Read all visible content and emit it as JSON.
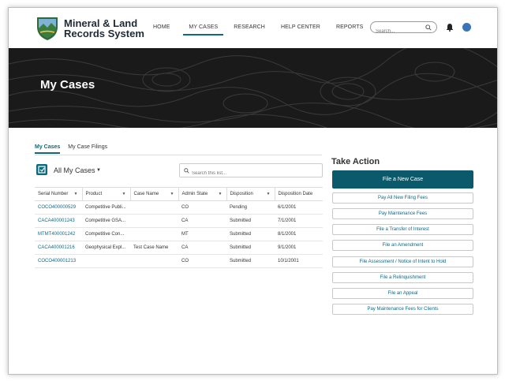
{
  "app": {
    "title_line1": "Mineral & Land",
    "title_line2": "Records System"
  },
  "nav": [
    {
      "label": "HOME"
    },
    {
      "label": "MY CASES"
    },
    {
      "label": "RESEARCH"
    },
    {
      "label": "HELP CENTER"
    },
    {
      "label": "REPORTS"
    }
  ],
  "search": {
    "placeholder": "Search..."
  },
  "hero": {
    "title": "My Cases"
  },
  "tabs": [
    {
      "label": "My Cases"
    },
    {
      "label": "My Case Filings"
    }
  ],
  "list_view": {
    "label": "All My Cases",
    "search_placeholder": "Search this list..."
  },
  "table": {
    "columns": [
      "Serial Number",
      "Product",
      "Case Name",
      "Admin State",
      "Disposition",
      "Disposition Date"
    ],
    "rows": [
      [
        "COCO400000529",
        "Competitive Publi...",
        "",
        "CO",
        "Pending",
        "6/1/2001"
      ],
      [
        "CACA400001243",
        "Competitive GSA...",
        "",
        "CA",
        "Submitted",
        "7/1/2001"
      ],
      [
        "MTMT400001242",
        "Competitive Con...",
        "",
        "MT",
        "Submitted",
        "8/1/2001"
      ],
      [
        "CACA400001216",
        "Geophysical Expl...",
        "Test Case Name",
        "CA",
        "Submitted",
        "9/1/2001"
      ],
      [
        "COCO400001213",
        "",
        "",
        "CO",
        "Submitted",
        "10/1/2001"
      ]
    ]
  },
  "take_action": {
    "title": "Take Action",
    "primary": "File a New Case",
    "buttons": [
      "Pay All New Filing Fees",
      "Pay Maintenance Fees",
      "File a Transfer of Interest",
      "File an Amendment",
      "File Assessment / Notice of Intent to Hold",
      "File a Relinquishment",
      "File an Appeal",
      "Pay Maintenance Fees for Clients"
    ]
  },
  "colors": {
    "accent": "#0b5a6b",
    "link": "#0b6a8a"
  }
}
